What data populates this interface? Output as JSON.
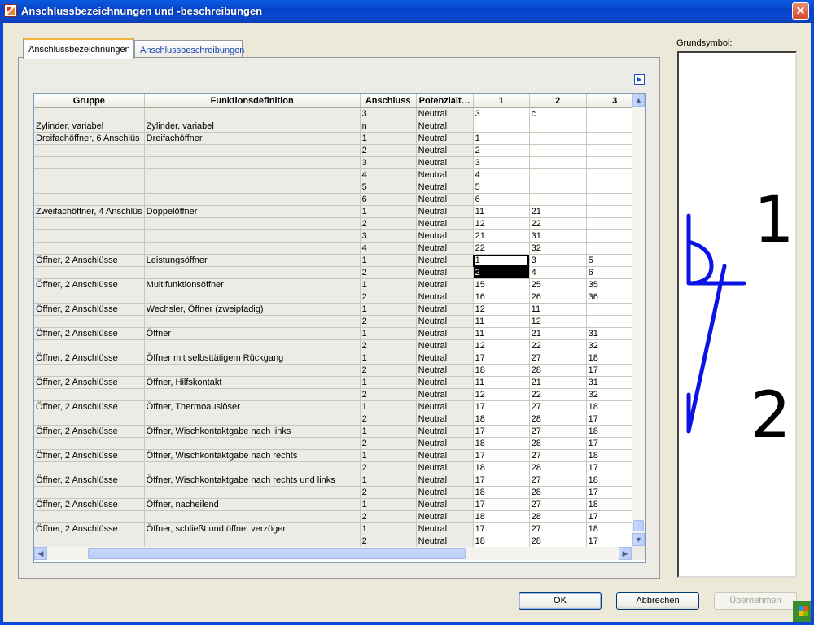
{
  "window": {
    "title": "Anschlussbezeichnungen und -beschreibungen",
    "close_glyph": "✕"
  },
  "tabs": [
    {
      "label": "Anschlussbezeichnungen",
      "active": true
    },
    {
      "label": "Anschlussbeschreibungen",
      "active": false
    }
  ],
  "table": {
    "columns": [
      "Gruppe",
      "Funktionsdefinition",
      "Anschluss",
      "Potenzialt…",
      "1",
      "2",
      "3"
    ],
    "rows": [
      [
        "",
        "",
        "3",
        "Neutral",
        "3",
        "c",
        ""
      ],
      [
        "Zylinder, variabel",
        "Zylinder, variabel",
        "n",
        "Neutral",
        "",
        "",
        ""
      ],
      [
        "Dreifachöffner, 6 Anschlüs",
        "Dreifachöffner",
        "1",
        "Neutral",
        "1",
        "",
        ""
      ],
      [
        "",
        "",
        "2",
        "Neutral",
        "2",
        "",
        ""
      ],
      [
        "",
        "",
        "3",
        "Neutral",
        "3",
        "",
        ""
      ],
      [
        "",
        "",
        "4",
        "Neutral",
        "4",
        "",
        ""
      ],
      [
        "",
        "",
        "5",
        "Neutral",
        "5",
        "",
        ""
      ],
      [
        "",
        "",
        "6",
        "Neutral",
        "6",
        "",
        ""
      ],
      [
        "Zweifachöffner, 4 Anschlüs",
        "Doppelöffner",
        "1",
        "Neutral",
        "11",
        "21",
        ""
      ],
      [
        "",
        "",
        "2",
        "Neutral",
        "12",
        "22",
        ""
      ],
      [
        "",
        "",
        "3",
        "Neutral",
        "21",
        "31",
        ""
      ],
      [
        "",
        "",
        "4",
        "Neutral",
        "22",
        "32",
        ""
      ],
      [
        "Öffner, 2 Anschlüsse",
        "Leistungsöffner",
        "1",
        "Neutral",
        "1",
        "3",
        "5"
      ],
      [
        "",
        "",
        "2",
        "Neutral",
        "2",
        "4",
        "6"
      ],
      [
        "Öffner, 2 Anschlüsse",
        "Multifunktionsöffner",
        "1",
        "Neutral",
        "15",
        "25",
        "35"
      ],
      [
        "",
        "",
        "2",
        "Neutral",
        "16",
        "26",
        "36"
      ],
      [
        "Öffner, 2 Anschlüsse",
        "Wechsler, Öffner (zweipfadig)",
        "1",
        "Neutral",
        "12",
        "11",
        ""
      ],
      [
        "",
        "",
        "2",
        "Neutral",
        "11",
        "12",
        ""
      ],
      [
        "Öffner, 2 Anschlüsse",
        "Öffner",
        "1",
        "Neutral",
        "11",
        "21",
        "31"
      ],
      [
        "",
        "",
        "2",
        "Neutral",
        "12",
        "22",
        "32"
      ],
      [
        "Öffner, 2 Anschlüsse",
        "Öffner mit selbsttätigem Rückgang",
        "1",
        "Neutral",
        "17",
        "27",
        "18"
      ],
      [
        "",
        "",
        "2",
        "Neutral",
        "18",
        "28",
        "17"
      ],
      [
        "Öffner, 2 Anschlüsse",
        "Öffner, Hilfskontakt",
        "1",
        "Neutral",
        "11",
        "21",
        "31"
      ],
      [
        "",
        "",
        "2",
        "Neutral",
        "12",
        "22",
        "32"
      ],
      [
        "Öffner, 2 Anschlüsse",
        "Öffner, Thermoauslöser",
        "1",
        "Neutral",
        "17",
        "27",
        "18"
      ],
      [
        "",
        "",
        "2",
        "Neutral",
        "18",
        "28",
        "17"
      ],
      [
        "Öffner, 2 Anschlüsse",
        "Öffner, Wischkontaktgabe nach links",
        "1",
        "Neutral",
        "17",
        "27",
        "18"
      ],
      [
        "",
        "",
        "2",
        "Neutral",
        "18",
        "28",
        "17"
      ],
      [
        "Öffner, 2 Anschlüsse",
        "Öffner, Wischkontaktgabe nach rechts",
        "1",
        "Neutral",
        "17",
        "27",
        "18"
      ],
      [
        "",
        "",
        "2",
        "Neutral",
        "18",
        "28",
        "17"
      ],
      [
        "Öffner, 2 Anschlüsse",
        "Öffner, Wischkontaktgabe nach rechts und links",
        "1",
        "Neutral",
        "17",
        "27",
        "18"
      ],
      [
        "",
        "",
        "2",
        "Neutral",
        "18",
        "28",
        "17"
      ],
      [
        "Öffner, 2 Anschlüsse",
        "Öffner, nacheilend",
        "1",
        "Neutral",
        "17",
        "27",
        "18"
      ],
      [
        "",
        "",
        "2",
        "Neutral",
        "18",
        "28",
        "17"
      ],
      [
        "Öffner, 2 Anschlüsse",
        "Öffner, schließt und öffnet verzögert",
        "1",
        "Neutral",
        "17",
        "27",
        "18"
      ],
      [
        "",
        "",
        "2",
        "Neutral",
        "18",
        "28",
        "17"
      ]
    ],
    "selected_outline_row": 12,
    "selected_fill_row": 13
  },
  "grundsymbol": {
    "label": "Grundsymbol:",
    "terminal_top": "1",
    "terminal_bottom": "2",
    "symbol_color": "#0a14e6"
  },
  "buttons": {
    "ok": "OK",
    "cancel": "Abbrechen",
    "apply": "Übernehmen"
  }
}
